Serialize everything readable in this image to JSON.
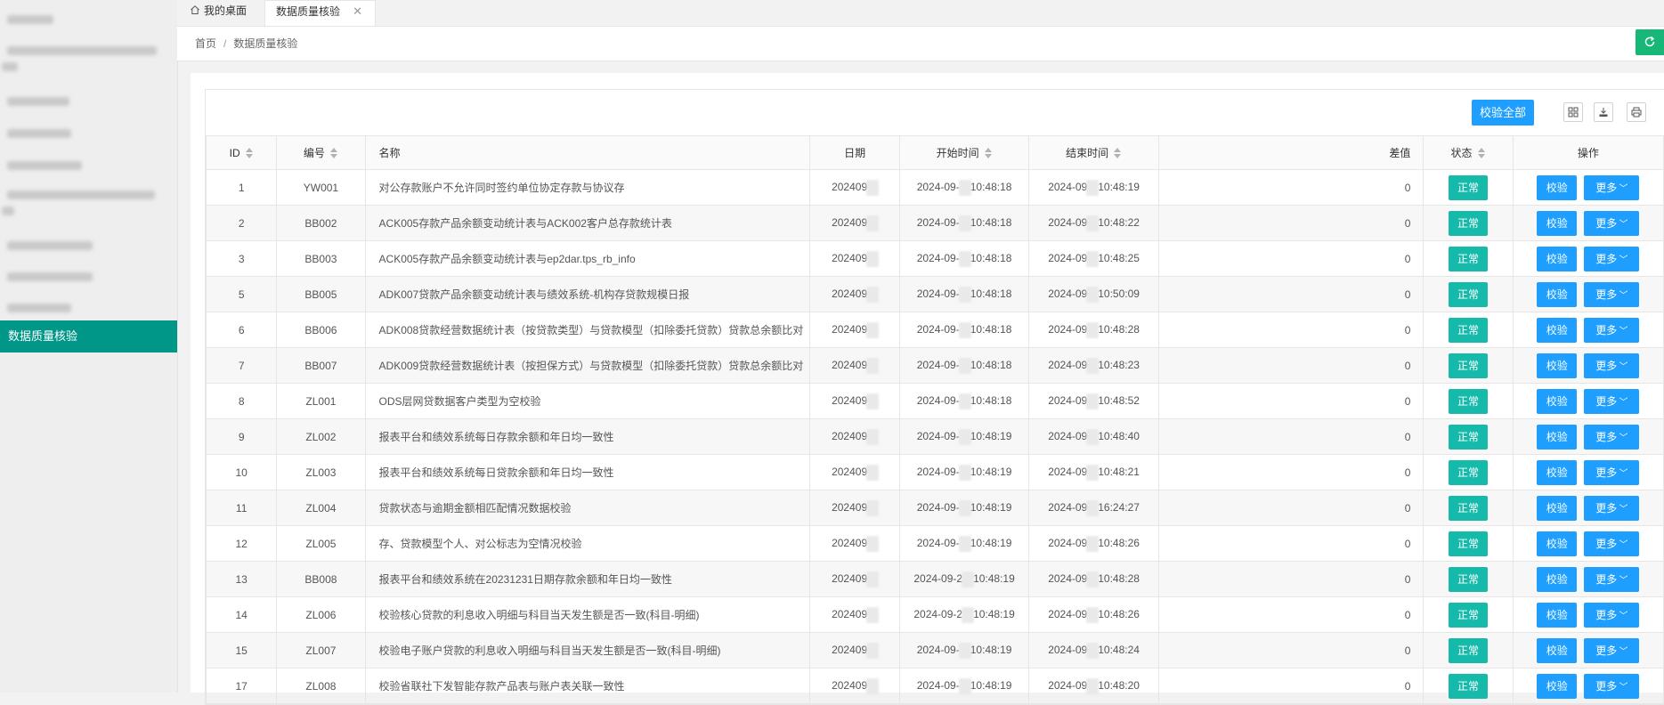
{
  "sidebar": {
    "active_label": "数据质量核验"
  },
  "tabs": {
    "home_label": "我的桌面",
    "current_label": "数据质量核验",
    "close_glyph": "✕"
  },
  "breadcrumb": {
    "home": "首页",
    "separator": "/",
    "current": "数据质量核验"
  },
  "toolbar": {
    "check_all_label": "校验全部"
  },
  "table": {
    "columns": {
      "id": "ID",
      "code": "编号",
      "name": "名称",
      "date": "日期",
      "start": "开始时间",
      "end": "结束时间",
      "diff": "差值",
      "status": "状态",
      "ops": "操作"
    },
    "check_label": "校验",
    "more_label": "更多",
    "more_arrow": "﹀",
    "rows": [
      {
        "id": "1",
        "code": "YW001",
        "name": "对公存款账户不允许同时签约单位协定存款与协议存",
        "date": "202409",
        "start_a": "2024-09-",
        "start_b": "10:48:18",
        "end_a": "2024-09",
        "end_b": "10:48:19",
        "diff": "0",
        "status": "正常"
      },
      {
        "id": "2",
        "code": "BB002",
        "name": "ACK005存款产品余额变动统计表与ACK002客户总存款统计表",
        "date": "202409",
        "start_a": "2024-09-",
        "start_b": "10:48:18",
        "end_a": "2024-09",
        "end_b": "10:48:22",
        "diff": "0",
        "status": "正常"
      },
      {
        "id": "3",
        "code": "BB003",
        "name": "ACK005存款产品余额变动统计表与ep2dar.tps_rb_info",
        "date": "202409",
        "start_a": "2024-09-",
        "start_b": "10:48:18",
        "end_a": "2024-09",
        "end_b": "10:48:25",
        "diff": "0",
        "status": "正常"
      },
      {
        "id": "5",
        "code": "BB005",
        "name": "ADK007贷款产品余额变动统计表与绩效系统-机构存贷款规模日报",
        "date": "202409",
        "start_a": "2024-09-",
        "start_b": "10:48:18",
        "end_a": "2024-09",
        "end_b": "10:50:09",
        "diff": "0",
        "status": "正常"
      },
      {
        "id": "6",
        "code": "BB006",
        "name": "ADK008贷款经营数据统计表（按贷款类型）与贷款模型（扣除委托贷款）贷款总余额比对",
        "date": "202409",
        "start_a": "2024-09-",
        "start_b": "10:48:18",
        "end_a": "2024-09",
        "end_b": "10:48:28",
        "diff": "0",
        "status": "正常"
      },
      {
        "id": "7",
        "code": "BB007",
        "name": "ADK009贷款经营数据统计表（按担保方式）与贷款模型（扣除委托贷款）贷款总余额比对",
        "date": "202409",
        "start_a": "2024-09-",
        "start_b": "10:48:18",
        "end_a": "2024-09",
        "end_b": "10:48:23",
        "diff": "0",
        "status": "正常"
      },
      {
        "id": "8",
        "code": "ZL001",
        "name": "ODS层网贷数据客户类型为空校验",
        "date": "202409",
        "start_a": "2024-09-",
        "start_b": "10:48:18",
        "end_a": "2024-09",
        "end_b": "10:48:52",
        "diff": "0",
        "status": "正常"
      },
      {
        "id": "9",
        "code": "ZL002",
        "name": "报表平台和绩效系统每日存款余额和年日均一致性",
        "date": "202409",
        "start_a": "2024-09-",
        "start_b": "10:48:19",
        "end_a": "2024-09",
        "end_b": "10:48:40",
        "diff": "0",
        "status": "正常"
      },
      {
        "id": "10",
        "code": "ZL003",
        "name": "报表平台和绩效系统每日贷款余额和年日均一致性",
        "date": "202409",
        "start_a": "2024-09-",
        "start_b": "10:48:19",
        "end_a": "2024-09",
        "end_b": "10:48:21",
        "diff": "0",
        "status": "正常"
      },
      {
        "id": "11",
        "code": "ZL004",
        "name": "贷款状态与逾期金额相匹配情况数据校验",
        "date": "202409",
        "start_a": "2024-09-",
        "start_b": "10:48:19",
        "end_a": "2024-09",
        "end_b": "16:24:27",
        "diff": "0",
        "status": "正常"
      },
      {
        "id": "12",
        "code": "ZL005",
        "name": "存、贷款模型个人、对公标志为空情况校验",
        "date": "202409",
        "start_a": "2024-09-",
        "start_b": "10:48:19",
        "end_a": "2024-09",
        "end_b": "10:48:26",
        "diff": "0",
        "status": "正常"
      },
      {
        "id": "13",
        "code": "BB008",
        "name": "报表平台和绩效系统在20231231日期存款余额和年日均一致性",
        "date": "202409",
        "start_a": "2024-09-2",
        "start_b": "10:48:19",
        "end_a": "2024-09",
        "end_b": "10:48:28",
        "diff": "0",
        "status": "正常"
      },
      {
        "id": "14",
        "code": "ZL006",
        "name": "校验核心贷款的利息收入明细与科目当天发生额是否一致(科目-明细)",
        "date": "202409",
        "start_a": "2024-09-2",
        "start_b": "10:48:19",
        "end_a": "2024-09",
        "end_b": "10:48:26",
        "diff": "0",
        "status": "正常"
      },
      {
        "id": "15",
        "code": "ZL007",
        "name": "校验电子账户贷款的利息收入明细与科目当天发生额是否一致(科目-明细)",
        "date": "202409",
        "start_a": "2024-09-",
        "start_b": "10:48:19",
        "end_a": "2024-09",
        "end_b": "10:48:24",
        "diff": "0",
        "status": "正常"
      },
      {
        "id": "17",
        "code": "ZL008",
        "name": "校验省联社下发智能存款产品表与账户表关联一致性",
        "date": "202409",
        "start_a": "2024-09-",
        "start_b": "10:48:19",
        "end_a": "2024-09",
        "end_b": "10:48:20",
        "diff": "0",
        "status": "正常"
      }
    ]
  }
}
